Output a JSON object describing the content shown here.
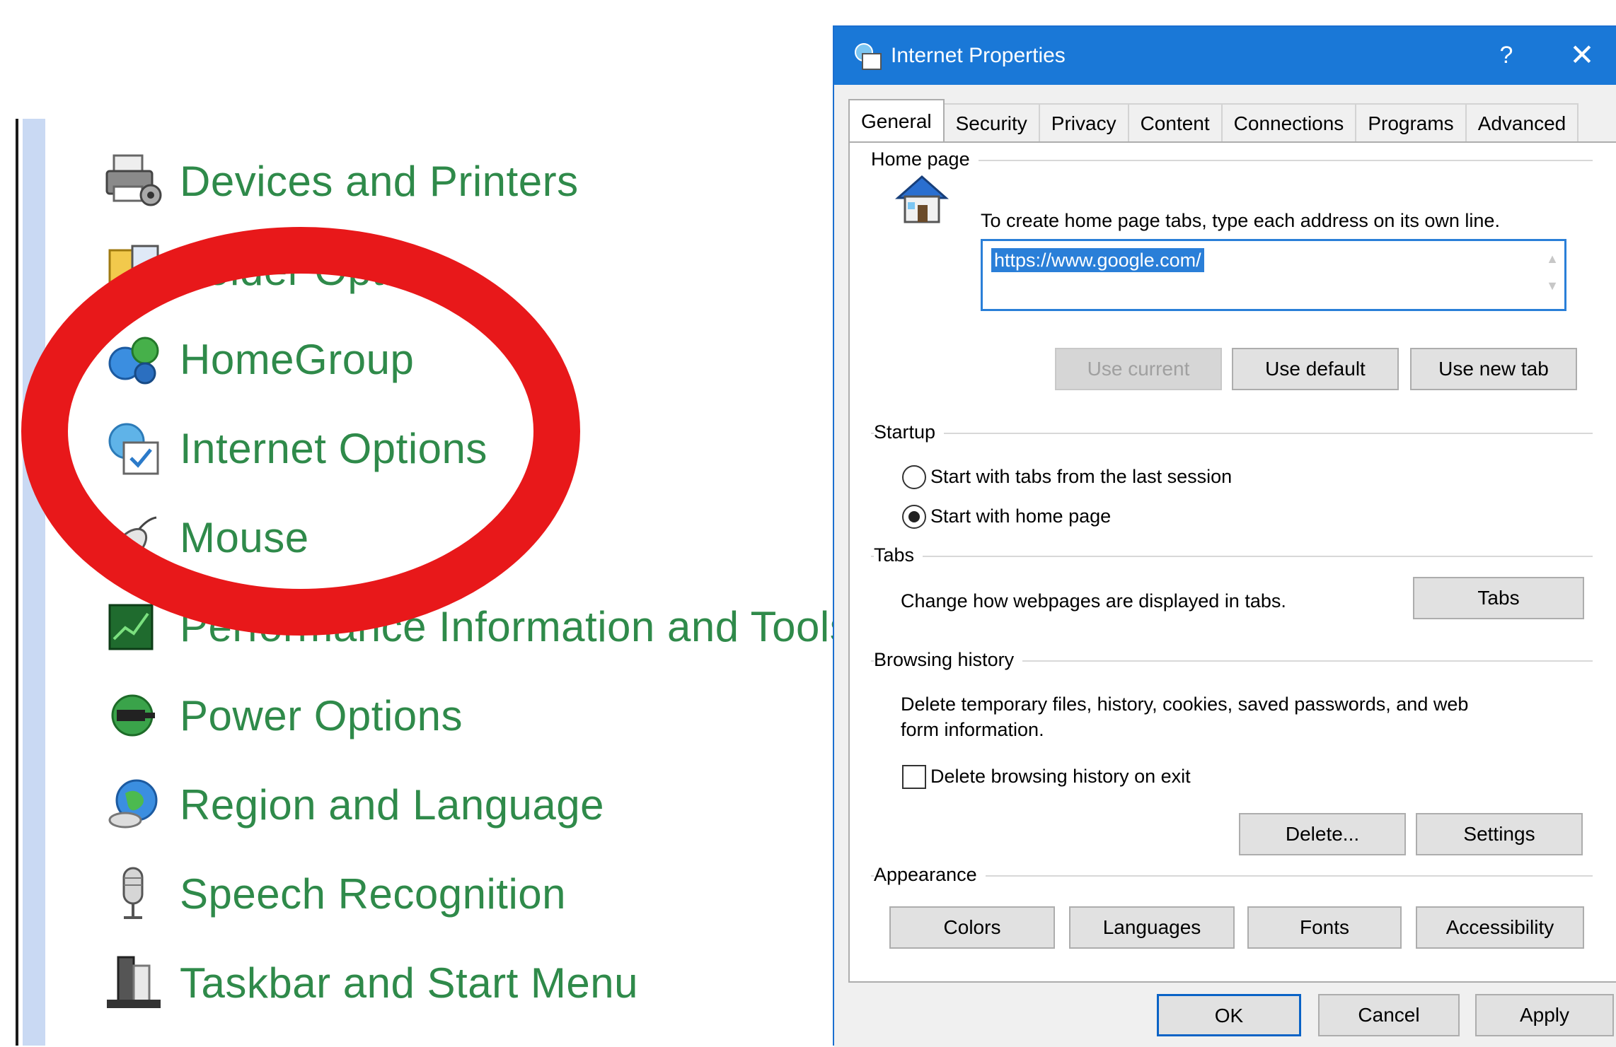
{
  "control_panel": {
    "items": [
      {
        "label": "Devices and Printers",
        "icon": "printer-icon"
      },
      {
        "label": "Folder Options",
        "icon": "folder-options-icon"
      },
      {
        "label": "HomeGroup",
        "icon": "homegroup-icon"
      },
      {
        "label": "Internet Options",
        "icon": "internet-options-icon"
      },
      {
        "label": "Mouse",
        "icon": "mouse-icon"
      },
      {
        "label": "Performance Information and Tools",
        "icon": "performance-icon"
      },
      {
        "label": "Power Options",
        "icon": "power-options-icon"
      },
      {
        "label": "Region and Language",
        "icon": "globe-icon"
      },
      {
        "label": "Speech Recognition",
        "icon": "microphone-icon"
      },
      {
        "label": "Taskbar and Start Menu",
        "icon": "taskbar-icon"
      }
    ],
    "highlight_color": "#e8181a"
  },
  "dialog": {
    "title": "Internet Properties",
    "help": "?",
    "close": "✕",
    "tabs": [
      "General",
      "Security",
      "Privacy",
      "Content",
      "Connections",
      "Programs",
      "Advanced"
    ],
    "active_tab": "General",
    "home_page": {
      "heading": "Home page",
      "hint": "To create home page tabs, type each address on its own line.",
      "url": "https://www.google.com/",
      "buttons": {
        "use_current": "Use current",
        "use_default": "Use default",
        "use_new_tab": "Use new tab"
      }
    },
    "startup": {
      "heading": "Startup",
      "option_last_session": "Start with tabs from the last session",
      "option_home_page": "Start with home page",
      "selected": "home_page"
    },
    "tabs_group": {
      "heading": "Tabs",
      "description": "Change how webpages are displayed in tabs.",
      "button": "Tabs"
    },
    "browsing_history": {
      "heading": "Browsing history",
      "description_line1": "Delete temporary files, history, cookies, saved passwords, and web",
      "description_line2": "form information.",
      "delete_on_exit": "Delete browsing history on exit",
      "delete_on_exit_checked": false,
      "delete_button": "Delete...",
      "settings_button": "Settings"
    },
    "appearance": {
      "heading": "Appearance",
      "buttons": {
        "colors": "Colors",
        "languages": "Languages",
        "fonts": "Fonts",
        "accessibility": "Accessibility"
      }
    },
    "footer": {
      "ok": "OK",
      "cancel": "Cancel",
      "apply": "Apply"
    },
    "titlebar_color": "#1a78d7"
  }
}
